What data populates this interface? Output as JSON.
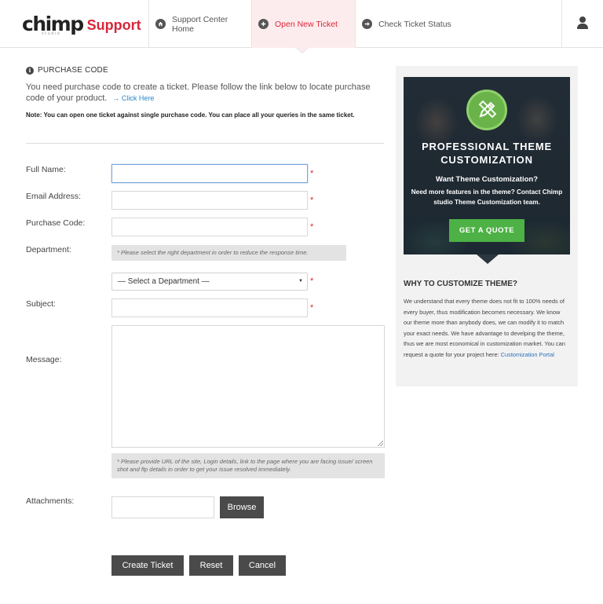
{
  "header": {
    "logo_main": "chimp",
    "logo_sub": "studio",
    "logo_support": "Support",
    "nav": [
      {
        "label": "Support Center Home",
        "icon": "home-icon",
        "active": false
      },
      {
        "label": "Open New Ticket",
        "icon": "plus-icon",
        "active": true
      },
      {
        "label": "Check Ticket Status",
        "icon": "arrow-right-icon",
        "active": false
      }
    ],
    "accent_color": "#d9263a"
  },
  "purchase": {
    "title": "PURCHASE CODE",
    "description": "You need purchase code to create a ticket. Please follow the link below to locate purchase code of your product.",
    "link_label": "Click Here",
    "note": "Note: You can open one ticket against single purchase code. You can place all your queries in the same ticket."
  },
  "form": {
    "full_name_label": "Full Name:",
    "full_name_value": "",
    "email_label": "Email Address:",
    "email_value": "",
    "purchase_code_label": "Purchase Code:",
    "purchase_code_value": "",
    "department_label": "Department:",
    "department_hint": "* Please select the right department in order to reduce the response time.",
    "department_selected": "— Select a Department —",
    "subject_label": "Subject:",
    "subject_value": "",
    "message_label": "Message:",
    "message_hint": "* Please provide URL of the site, Login details, link to the page where you are facing issue/ screen shot and ftp details in order to get your issue resolved immediately.",
    "attachments_label": "Attachments:",
    "browse_label": "Browse",
    "required_mark": "*",
    "create_label": "Create Ticket",
    "reset_label": "Reset",
    "cancel_label": "Cancel"
  },
  "sidebar": {
    "promo_title": "PROFESSIONAL THEME CUSTOMIZATION",
    "promo_subtitle": "Want Theme Customization?",
    "promo_desc": "Need more features in the theme? Contact Chimp studio Theme Customization team.",
    "promo_button": "GET A QUOTE",
    "promo_icon": "pencil-ruler-icon",
    "why_title": "WHY TO CUSTOMIZE THEME?",
    "why_text": "We understand that every theme does not fit to 100% needs of every buyer, thus modification becomes necessary. We know our theme more than anybody does, we can modify it to match your exact needs. We have advantage to develping the theme, thus we are most economical in customization market. You can request a quote for your project here: ",
    "why_link": "Customization Portal"
  }
}
